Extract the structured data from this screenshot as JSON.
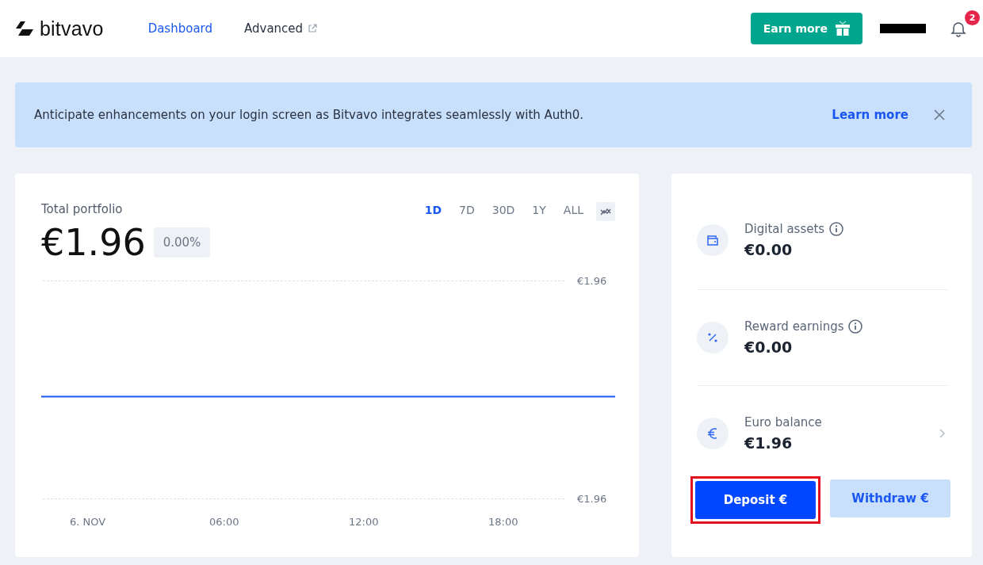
{
  "header": {
    "logo": "bitvavo",
    "nav": [
      {
        "label": "Dashboard",
        "selected": true,
        "external": false
      },
      {
        "label": "Advanced",
        "selected": false,
        "external": true
      }
    ],
    "earn_button": "Earn more",
    "notifications": {
      "count": "2"
    }
  },
  "banner": {
    "text": "Anticipate enhancements on your login screen as Bitvavo integrates seamlessly with Auth0.",
    "link": "Learn more"
  },
  "portfolio": {
    "title": "Total portfolio",
    "value": "€1.96",
    "change": "0.00%",
    "ranges": [
      {
        "label": "1D",
        "selected": true
      },
      {
        "label": "7D",
        "selected": false
      },
      {
        "label": "30D",
        "selected": false
      },
      {
        "label": "1Y",
        "selected": false
      },
      {
        "label": "ALL",
        "selected": false
      }
    ],
    "y_labels": [
      "€1.96",
      "€1.96"
    ],
    "x_labels": [
      "6. NOV",
      "06:00",
      "12:00",
      "18:00"
    ]
  },
  "balances": [
    {
      "kind": "info",
      "label": "Digital assets",
      "value": "€0.00"
    },
    {
      "kind": "info",
      "label": "Reward earnings",
      "value": "€0.00"
    },
    {
      "kind": "link",
      "label": "Euro balance",
      "value": "€1.96"
    }
  ],
  "buttons": [
    {
      "label": "Deposit €",
      "primary": true,
      "highlighted": true
    },
    {
      "label": "Withdraw €",
      "primary": false,
      "highlighted": false
    }
  ]
}
